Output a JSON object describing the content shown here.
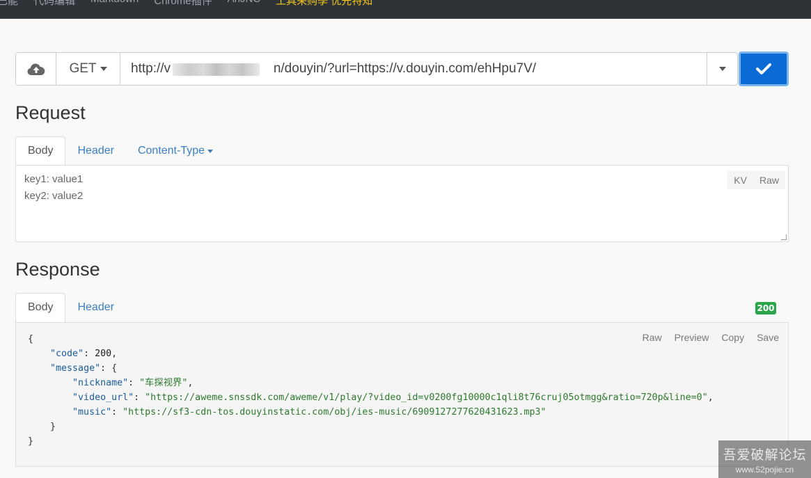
{
  "topnav": {
    "items": [
      "巴能",
      "代码编辑",
      "Markdown",
      "Chrome插件",
      "AnJNC"
    ],
    "highlight": "工具采购季 优先特知"
  },
  "request_bar": {
    "method": "GET",
    "url": "http://v                            n/douyin/?url=https://v.douyin.com/ehHpu7V/"
  },
  "request": {
    "title": "Request",
    "tabs": [
      "Body",
      "Header",
      "Content-Type"
    ],
    "body_lines": [
      "key1: value1",
      "key2: value2"
    ],
    "modes": [
      "KV",
      "Raw"
    ]
  },
  "response": {
    "title": "Response",
    "tabs": [
      "Body",
      "Header"
    ],
    "status": "200",
    "actions": [
      "Raw",
      "Preview",
      "Copy",
      "Save"
    ],
    "json": {
      "code": "200",
      "nickname": "车探视界",
      "video_url": "https://aweme.snssdk.com/aweme/v1/play/?video_id=v0200fg10000c1qli8t76cruj05otmgg&ratio=720p&line=0",
      "music": "https://sf3-cdn-tos.douyinstatic.com/obj/ies-music/6909127277620431623.mp3"
    }
  },
  "watermark": {
    "line1": "吾爱破解论坛",
    "line2": "www.52pojie.cn"
  },
  "colors": {
    "nav_bg": "#2f3338",
    "primary": "#0a6bd6",
    "link": "#3a7ec2",
    "success": "#2ca44a"
  }
}
